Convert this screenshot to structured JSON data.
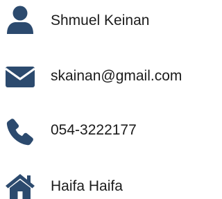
{
  "contact": {
    "name": "Shmuel Keinan",
    "email": "skainan@gmail.com",
    "phone": "054-3222177",
    "address": "Haifa Haifa"
  },
  "icons": {
    "name": "user-icon",
    "email": "envelope-icon",
    "phone": "phone-icon",
    "address": "home-icon"
  },
  "colors": {
    "icon": "#2c4a6e",
    "text": "#1b1b1b"
  }
}
